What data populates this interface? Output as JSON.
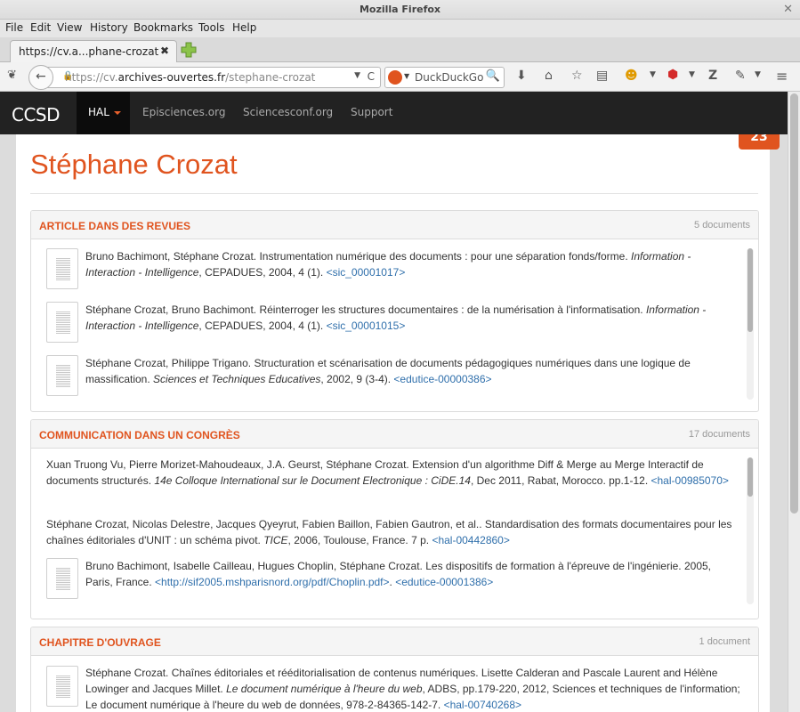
{
  "window": {
    "title": "Mozilla Firefox"
  },
  "menu": [
    "File",
    "Edit",
    "View",
    "History",
    "Bookmarks",
    "Tools",
    "Help"
  ],
  "tab": {
    "label": "https://cv.a...phane-crozat"
  },
  "url": {
    "prefix": "https://cv.",
    "domain": "archives-ouvertes.fr",
    "path": "/stephane-crozat"
  },
  "search": {
    "placeholder": "DuckDuckGo"
  },
  "site": {
    "logo": "CCSD",
    "hal": "HAL",
    "links": [
      "Episciences.org",
      "Sciencesconf.org",
      "Support"
    ],
    "badge": "23"
  },
  "person": {
    "name": "Stéphane Crozat"
  },
  "sections": [
    {
      "title": "ARTICLE DANS DES REVUES",
      "count": "5 documents",
      "entries": [
        {
          "authors": "Bruno Bachimont, Stéphane Crozat. Instrumentation numérique des documents : pour une séparation fonds/forme. ",
          "venue": "Information - Interaction - Intelligence",
          "rest": ", CEPADUES, 2004, 4 (1). ",
          "link": "<sic_00001017>"
        },
        {
          "authors": "Stéphane Crozat, Bruno Bachimont. Réinterroger les structures documentaires : de la numérisation à l'informatisation. ",
          "venue": "Information - Interaction - Intelligence",
          "rest": ", CEPADUES, 2004, 4 (1). ",
          "link": "<sic_00001015>"
        },
        {
          "authors": "Stéphane Crozat, Philippe Trigano. Structuration et scénarisation de documents pédagogiques numériques dans une logique de massification. ",
          "venue": "Sciences et Techniques Educatives",
          "rest": ", 2002, 9 (3-4). ",
          "link": "<edutice-00000386>"
        }
      ]
    },
    {
      "title": "COMMUNICATION DANS UN CONGRÈS",
      "count": "17 documents",
      "entries": [
        {
          "authors": "Xuan Truong Vu, Pierre Morizet-Mahoudeaux, J.A. Geurst, Stéphane Crozat. Extension d'un algorithme Diff & Merge au Merge Interactif de documents structurés. ",
          "venue": "14e Colloque International sur le Document Electronique : CiDE.14",
          "rest": ", Dec 2011, Rabat, Morocco. pp.1-12. ",
          "link": "<hal-00985070>"
        },
        {
          "authors": "Stéphane Crozat, Nicolas Delestre, Jacques Qyeyrut, Fabien Baillon, Fabien Gautron, et al.. Standardisation des formats documentaires pour les chaînes éditoriales d'UNIT : un schéma pivot. ",
          "venue": "TICE",
          "rest": ", 2006, Toulouse, France. 7 p. ",
          "link": "<hal-00442860>"
        },
        {
          "authors": "Bruno Bachimont, Isabelle Cailleau, Hugues Choplin, Stéphane Crozat. Les dispositifs de formation à l'épreuve de l'ingénierie. 2005, Paris, France. ",
          "venue": "",
          "rest": "",
          "link": "<http://sif2005.mshparisnord.org/pdf/Choplin.pdf>",
          "link2": "<edutice-00001386>"
        }
      ]
    },
    {
      "title": "CHAPITRE D'OUVRAGE",
      "count": "1 document",
      "entries": [
        {
          "authors": "Stéphane Crozat. Chaînes éditoriales et rééditorialisation de contenus numériques. Lisette Calderan and Pascale Laurent and Hélène Lowinger and Jacques Millet. ",
          "venue": "Le document numérique à l'heure du web",
          "rest": ", ADBS, pp.179-220, 2012, Sciences et techniques de l'information; Le document numérique à l'heure du web de données, 978-2-84365-142-7. ",
          "link": "<hal-00740268>"
        }
      ]
    }
  ]
}
